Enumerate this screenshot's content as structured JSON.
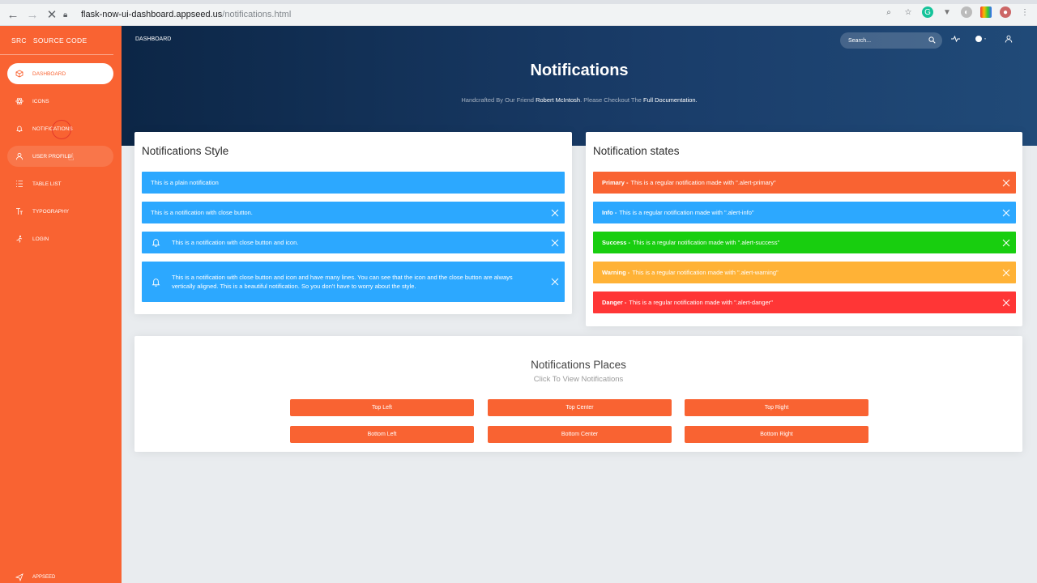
{
  "browser": {
    "url_host": "flask-now-ui-dashboard.appseed.us",
    "url_path": "/notifications.html"
  },
  "sidebar": {
    "brand_mini": "SRC",
    "brand_name": "SOURCE CODE",
    "items": [
      {
        "label": "DASHBOARD",
        "icon": "box-icon"
      },
      {
        "label": "ICONS",
        "icon": "atom-icon"
      },
      {
        "label": "NOTIFICATIONS",
        "icon": "bell-icon"
      },
      {
        "label": "USER PROFILE",
        "icon": "user-icon"
      },
      {
        "label": "TABLE LIST",
        "icon": "list-icon"
      },
      {
        "label": "TYPOGRAPHY",
        "icon": "text-icon"
      },
      {
        "label": "LOGIN",
        "icon": "login-icon"
      }
    ],
    "bottom_label": "APPSEED"
  },
  "header": {
    "breadcrumb": "DASHBOARD",
    "search_placeholder": "Search...",
    "title": "Notifications",
    "subtitle_pre": "Handcrafted By Our Friend ",
    "subtitle_name": "Robert McIntosh",
    "subtitle_mid": ". Please Checkout The ",
    "subtitle_link": "Full Documentation."
  },
  "style_card": {
    "title": "Notifications Style",
    "alerts": [
      "This is a plain notification",
      "This is a notification with close button.",
      "This is a notification with close button and icon.",
      "This is a notification with close button and icon and have many lines. You can see that the icon and the close button are always vertically aligned. This is a beautiful notification. So you don't have to worry about the style."
    ]
  },
  "states_card": {
    "title": "Notification states",
    "alerts": [
      {
        "strong": "Primary -",
        "text": "This is a regular notification made with \".alert-primary\"",
        "color": "#f96332"
      },
      {
        "strong": "Info -",
        "text": "This is a regular notification made with \".alert-info\"",
        "color": "#2ca8ff"
      },
      {
        "strong": "Success -",
        "text": "This is a regular notification made with \".alert-success\"",
        "color": "#18ce0f"
      },
      {
        "strong": "Warning -",
        "text": "This is a regular notification made with \".alert-warning\"",
        "color": "#ffb236"
      },
      {
        "strong": "Danger -",
        "text": "This is a regular notification made with \".alert-danger\"",
        "color": "#ff3636"
      }
    ]
  },
  "places_card": {
    "title": "Notifications Places",
    "subtitle": "Click To View Notifications",
    "buttons": [
      "Top Left",
      "Top Center",
      "Top Right",
      "Bottom Left",
      "Bottom Center",
      "Bottom Right"
    ]
  },
  "colors": {
    "sidebar": "#f96332",
    "info_alert": "#2ca8ff"
  }
}
